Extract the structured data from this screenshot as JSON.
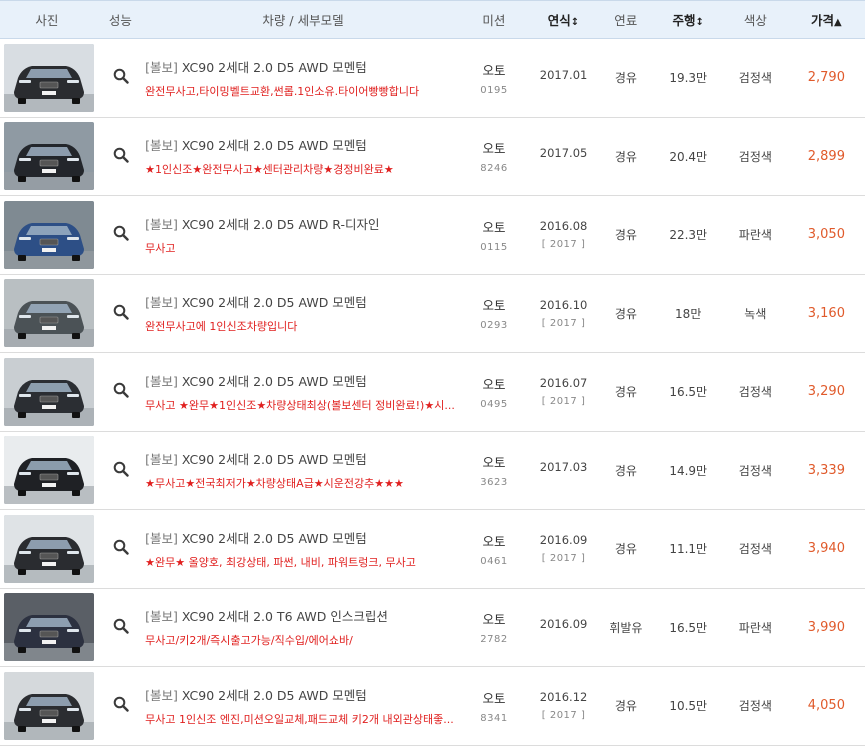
{
  "header": {
    "photo": "사진",
    "perf": "성능",
    "model": "차량 / 세부모델",
    "trans": "미션",
    "year": "연식",
    "year_arrow": "↕",
    "fuel": "연료",
    "mileage": "주행",
    "mileage_arrow": "↕",
    "color": "색상",
    "price": "가격",
    "price_arrow": "▲"
  },
  "colors": {
    "accent_red": "#e0201f",
    "price": "#e05a2b",
    "header_bg": "#e8f1fa"
  },
  "rows": [
    {
      "brand": "[볼보]",
      "model": "XC90 2세대 2.0 D5 AWD 모멘텀",
      "desc": "완전무사고,타이밍벨트교환,썬롭.1인소유.타이어빵빵합니다",
      "trans": "오토",
      "code": "0195",
      "year": "2017.01",
      "reg": "",
      "fuel": "경유",
      "mileage": "19.3만",
      "color": "검정색",
      "price": "2,790",
      "car_color": "#2a2c30",
      "bg": "#d8dde2"
    },
    {
      "brand": "[볼보]",
      "model": "XC90 2세대 2.0 D5 AWD 모멘텀",
      "desc": "★1인신조★완전무사고★센터관리차량★경정비완료★",
      "trans": "오토",
      "code": "8246",
      "year": "2017.05",
      "reg": "",
      "fuel": "경유",
      "mileage": "20.4만",
      "color": "검정색",
      "price": "2,899",
      "car_color": "#23262b",
      "bg": "#8f9aa3"
    },
    {
      "brand": "[볼보]",
      "model": "XC90 2세대 2.0 D5 AWD R-디자인",
      "desc": "무사고",
      "trans": "오토",
      "code": "0115",
      "year": "2016.08",
      "reg": "[ 2017 ]",
      "fuel": "경유",
      "mileage": "22.3만",
      "color": "파란색",
      "price": "3,050",
      "car_color": "#2d4f86",
      "bg": "#7f8a92"
    },
    {
      "brand": "[볼보]",
      "model": "XC90 2세대 2.0 D5 AWD 모멘텀",
      "desc": "완전무사고에 1인신조차량입니다",
      "trans": "오토",
      "code": "0293",
      "year": "2016.10",
      "reg": "[ 2017 ]",
      "fuel": "경유",
      "mileage": "18만",
      "color": "녹색",
      "price": "3,160",
      "car_color": "#4b5256",
      "bg": "#b9bfc2"
    },
    {
      "brand": "[볼보]",
      "model": "XC90 2세대 2.0 D5 AWD 모멘텀",
      "desc": "무사고 ★완무★1인신조★차량상태최상(볼보센터 정비완료!)★시...",
      "trans": "오토",
      "code": "0495",
      "year": "2016.07",
      "reg": "[ 2017 ]",
      "fuel": "경유",
      "mileage": "16.5만",
      "color": "검정색",
      "price": "3,290",
      "car_color": "#2b2e33",
      "bg": "#c9ced2"
    },
    {
      "brand": "[볼보]",
      "model": "XC90 2세대 2.0 D5 AWD 모멘텀",
      "desc": "★무사고★전국최저가★차량상태A급★시운전강추★★★",
      "trans": "오토",
      "code": "3623",
      "year": "2017.03",
      "reg": "",
      "fuel": "경유",
      "mileage": "14.9만",
      "color": "검정색",
      "price": "3,339",
      "car_color": "#1f2125",
      "bg": "#e9ecee"
    },
    {
      "brand": "[볼보]",
      "model": "XC90 2세대 2.0 D5 AWD 모멘텀",
      "desc": "★완무★ 올양호, 최강상태, 파썬, 내비, 파워트렁크, 무사고",
      "trans": "오토",
      "code": "0461",
      "year": "2016.09",
      "reg": "[ 2017 ]",
      "fuel": "경유",
      "mileage": "11.1만",
      "color": "검정색",
      "price": "3,940",
      "car_color": "#2a2c30",
      "bg": "#dfe3e6"
    },
    {
      "brand": "[볼보]",
      "model": "XC90 2세대 2.0 T6 AWD 인스크립션",
      "desc": "무사고/키2개/즉시출고가능/직수입/에어쇼바/",
      "trans": "오토",
      "code": "2782",
      "year": "2016.09",
      "reg": "",
      "fuel": "휘발유",
      "mileage": "16.5만",
      "color": "파란색",
      "price": "3,990",
      "car_color": "#2c3140",
      "bg": "#5a5f66"
    },
    {
      "brand": "[볼보]",
      "model": "XC90 2세대 2.0 D5 AWD 모멘텀",
      "desc": "무사고 1인신조 엔진,미션오일교체,패드교체 키2개 내외관상태좋...",
      "trans": "오토",
      "code": "8341",
      "year": "2016.12",
      "reg": "[ 2017 ]",
      "fuel": "경유",
      "mileage": "10.5만",
      "color": "검정색",
      "price": "4,050",
      "car_color": "#2b2d31",
      "bg": "#d5d9dc"
    }
  ]
}
